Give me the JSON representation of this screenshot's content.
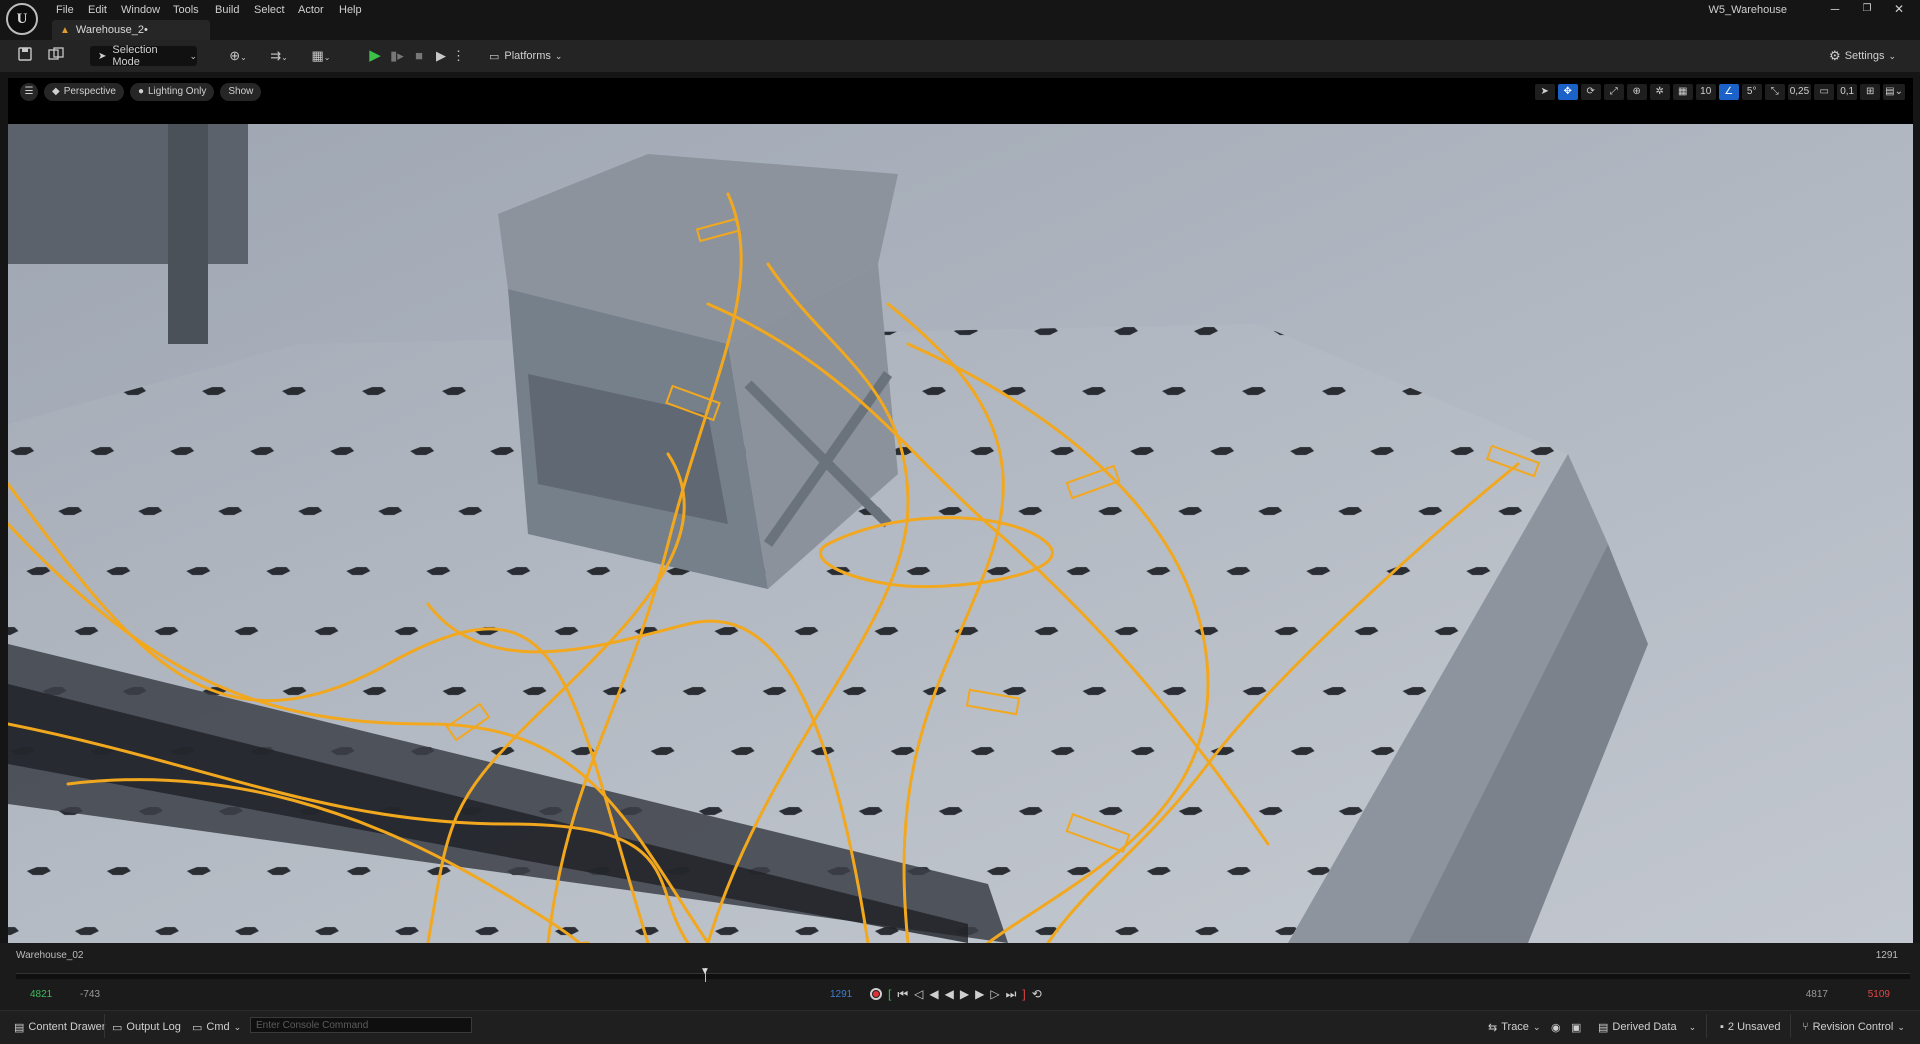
{
  "app": {
    "logo_text": "U",
    "menu": [
      "File",
      "Edit",
      "Window",
      "Tools",
      "Build",
      "Select",
      "Actor",
      "Help"
    ],
    "document_tab": "Warehouse_2•",
    "window_title": "W5_Warehouse",
    "window_controls": {
      "minimize": "─",
      "restore": "❐",
      "close": "✕"
    }
  },
  "toolbar": {
    "selection_mode": "Selection Mode",
    "platforms": "Platforms",
    "settings": "Settings"
  },
  "viewport": {
    "perspective": "Perspective",
    "view_mode": "Lighting Only",
    "show": "Show",
    "grid_snap": "10",
    "rotation_snap": "5°",
    "scale_snap": "0,25",
    "camera_speed": "0,1"
  },
  "sequencer": {
    "level": "Warehouse_02",
    "end_frame_display": "1291",
    "current_frame": "1291",
    "start_in": "4821",
    "start_view": "-743",
    "end_view": "4817",
    "end_out": "5109"
  },
  "statusbar": {
    "content_drawer": "Content Drawer",
    "output_log": "Output Log",
    "cmd": "Cmd",
    "console_placeholder": "Enter Console Command",
    "trace": "Trace",
    "derived_data": "Derived Data",
    "unsaved": "2 Unsaved",
    "revision_control": "Revision Control"
  },
  "colors": {
    "accent_blue": "#1a61c8",
    "selection_orange": "#f2a81e",
    "play_green": "#3cc04a",
    "record_red": "#e0303a"
  }
}
